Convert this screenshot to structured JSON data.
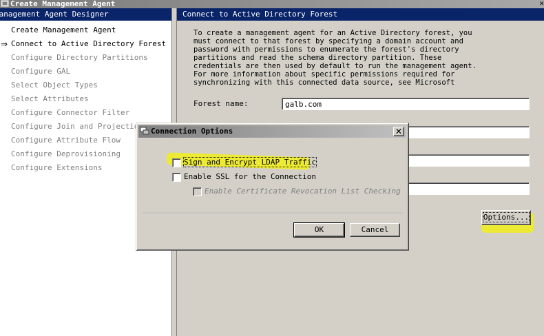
{
  "window": {
    "title": "Create Management Agent"
  },
  "left_pane": {
    "header": "Management Agent Designer",
    "items": [
      {
        "label": "Create Management Agent",
        "state": "done"
      },
      {
        "label": "Connect to Active Directory Forest",
        "state": "current"
      },
      {
        "label": "Configure Directory Partitions",
        "state": "disabled"
      },
      {
        "label": "Configure GAL",
        "state": "disabled"
      },
      {
        "label": "Select Object Types",
        "state": "disabled"
      },
      {
        "label": "Select Attributes",
        "state": "disabled"
      },
      {
        "label": "Configure Connector Filter",
        "state": "disabled"
      },
      {
        "label": "Configure Join and Projection",
        "state": "disabled"
      },
      {
        "label": "Configure Attribute Flow",
        "state": "disabled"
      },
      {
        "label": "Configure Deprovisioning",
        "state": "disabled"
      },
      {
        "label": "Configure Extensions",
        "state": "disabled"
      }
    ]
  },
  "right_pane": {
    "header": "Connect to Active Directory Forest",
    "description": "To create a management agent for an Active Directory forest, you\nmust connect to that forest by specifying a domain account and\npassword with permissions to enumerate the forest's directory\npartitions and read the schema directory partition. These\ncredentials are then used by default to run the management agent.\nFor more information about specific permissions required for\nsynchronizing with this connected data source, see Microsoft",
    "forest_name_label": "Forest name:",
    "forest_name_value": "galb.com",
    "options_button": "Options..."
  },
  "dialog": {
    "title": "Connection Options",
    "sign_encrypt_label": "Sign and Encrypt LDAP Traffic",
    "sign_encrypt_checked": false,
    "ssl_label": "Enable SSL for the Connection",
    "ssl_checked": false,
    "crl_label": "Enable Certificate Revocation List Checking",
    "crl_checked": false,
    "ok_button": "OK",
    "cancel_button": "Cancel"
  },
  "colors": {
    "highlight": "#f4f300",
    "header_bg": "#0a246a",
    "face": "#d4d0c8"
  }
}
